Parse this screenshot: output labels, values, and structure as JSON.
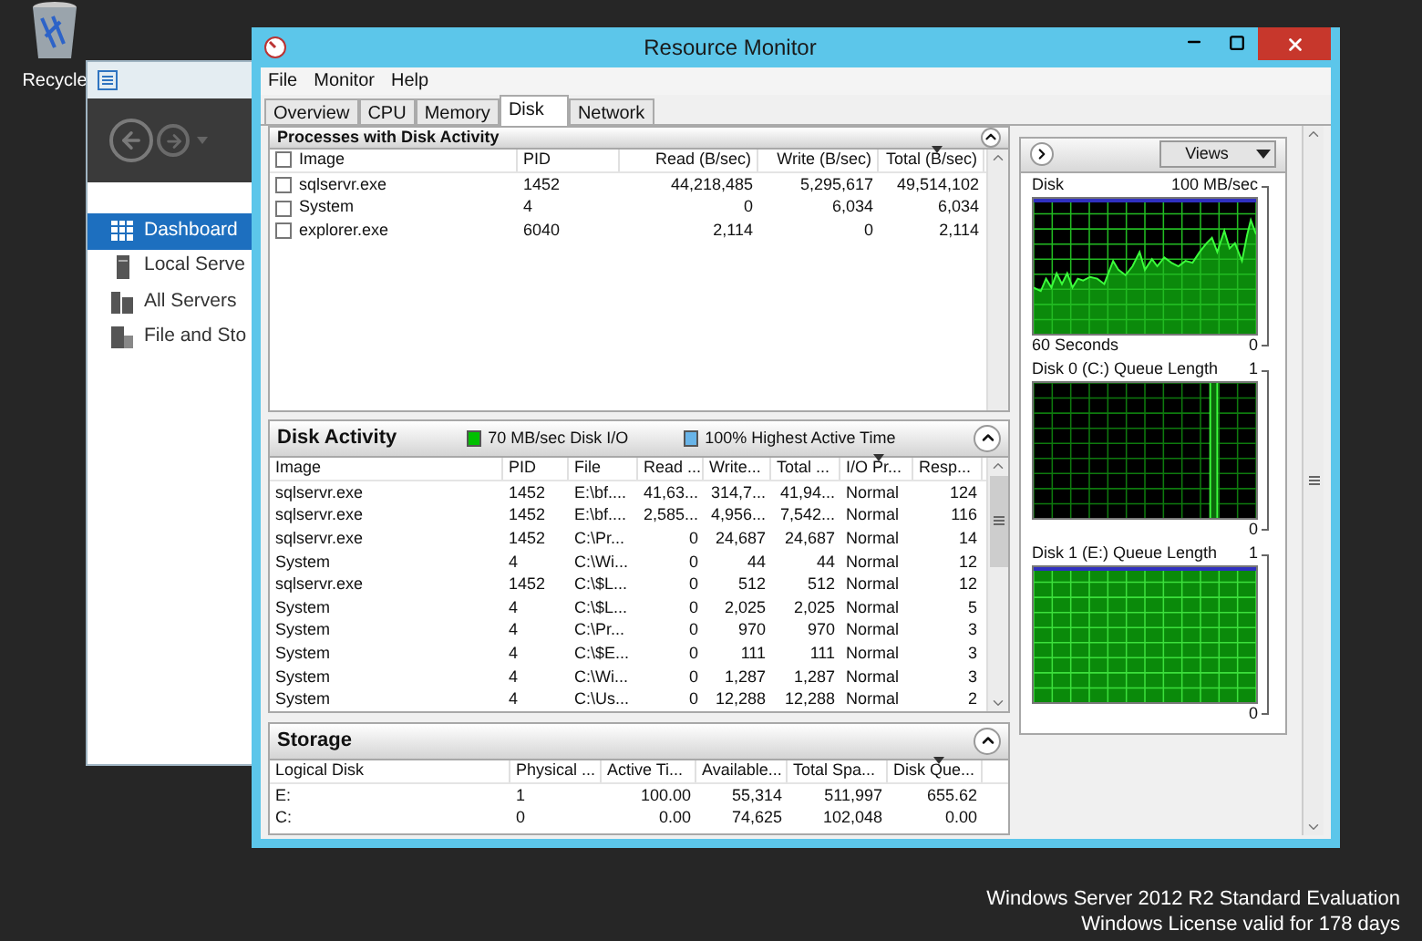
{
  "desktop": {
    "icons": [
      {
        "label": "Recycle"
      }
    ],
    "notice": [
      "Windows Server 2012 R2 Standard Evaluation",
      "Windows License valid for 178 days"
    ]
  },
  "server_manager": {
    "sidebar": {
      "items": [
        {
          "label": "Dashboard",
          "kind": "dashboard",
          "selected": true
        },
        {
          "label": "Local Serve",
          "kind": "server",
          "selected": false
        },
        {
          "label": "All Servers",
          "kind": "servers",
          "selected": false
        },
        {
          "label": "File and Sto",
          "kind": "storage",
          "selected": false
        }
      ]
    }
  },
  "resource_monitor": {
    "window": {
      "title": "Resource Monitor"
    },
    "menu": [
      "File",
      "Monitor",
      "Help"
    ],
    "tabs": [
      {
        "label": "Overview",
        "selected": false
      },
      {
        "label": "CPU",
        "selected": false
      },
      {
        "label": "Memory",
        "selected": false
      },
      {
        "label": "Disk",
        "selected": true
      },
      {
        "label": "Network",
        "selected": false
      }
    ],
    "processes": {
      "title": "Processes with Disk Activity",
      "expanded": true,
      "all_checked": false,
      "columns": [
        {
          "label": "Image",
          "sorted": false
        },
        {
          "label": "PID",
          "sorted": false
        },
        {
          "label": "Read (B/sec)",
          "sorted": false
        },
        {
          "label": "Write (B/sec)",
          "sorted": false
        },
        {
          "label": "Total (B/sec)",
          "sorted": true
        }
      ],
      "rows": [
        {
          "checked": false,
          "cells": [
            "sqlservr.exe",
            "1452",
            "44,218,485",
            "5,295,617",
            "49,514,102"
          ]
        },
        {
          "checked": false,
          "cells": [
            "System",
            "4",
            "0",
            "6,034",
            "6,034"
          ]
        },
        {
          "checked": false,
          "cells": [
            "explorer.exe",
            "6040",
            "2,114",
            "0",
            "2,114"
          ]
        }
      ]
    },
    "disk_activity": {
      "title": "Disk Activity",
      "expanded": true,
      "legend": [
        {
          "label": "70 MB/sec Disk I/O",
          "color": "#00c000"
        },
        {
          "label": "100% Highest Active Time",
          "color": "#68b4e8"
        }
      ],
      "columns": [
        {
          "label": "Image",
          "sorted": false
        },
        {
          "label": "PID",
          "sorted": false
        },
        {
          "label": "File",
          "sorted": false
        },
        {
          "label": "Read ...",
          "sorted": false
        },
        {
          "label": "Write...",
          "sorted": false
        },
        {
          "label": "Total ...",
          "sorted": false
        },
        {
          "label": "I/O Pr...",
          "sorted": true
        },
        {
          "label": "Resp...",
          "sorted": false
        }
      ],
      "rows": [
        [
          "sqlservr.exe",
          "1452",
          "E:\\bf....",
          "41,63...",
          "314,7...",
          "41,94...",
          "Normal",
          "124"
        ],
        [
          "sqlservr.exe",
          "1452",
          "E:\\bf....",
          "2,585...",
          "4,956...",
          "7,542...",
          "Normal",
          "116"
        ],
        [
          "sqlservr.exe",
          "1452",
          "C:\\Pr...",
          "0",
          "24,687",
          "24,687",
          "Normal",
          "14"
        ],
        [
          "System",
          "4",
          "C:\\Wi...",
          "0",
          "44",
          "44",
          "Normal",
          "12"
        ],
        [
          "sqlservr.exe",
          "1452",
          "C:\\$L...",
          "0",
          "512",
          "512",
          "Normal",
          "12"
        ],
        [
          "System",
          "4",
          "C:\\$L...",
          "0",
          "2,025",
          "2,025",
          "Normal",
          "5"
        ],
        [
          "System",
          "4",
          "C:\\Pr...",
          "0",
          "970",
          "970",
          "Normal",
          "3"
        ],
        [
          "System",
          "4",
          "C:\\$E...",
          "0",
          "111",
          "111",
          "Normal",
          "3"
        ],
        [
          "System",
          "4",
          "C:\\Wi...",
          "0",
          "1,287",
          "1,287",
          "Normal",
          "3"
        ],
        [
          "System",
          "4",
          "C:\\Us...",
          "0",
          "12,288",
          "12,288",
          "Normal",
          "2"
        ]
      ]
    },
    "storage": {
      "title": "Storage",
      "expanded": true,
      "columns": [
        {
          "label": "Logical Disk",
          "sorted": false
        },
        {
          "label": "Physical ...",
          "sorted": false
        },
        {
          "label": "Active Ti...",
          "sorted": false
        },
        {
          "label": "Available...",
          "sorted": false
        },
        {
          "label": "Total Spa...",
          "sorted": false
        },
        {
          "label": "Disk Que...",
          "sorted": true
        }
      ],
      "rows": [
        [
          "E:",
          "1",
          "100.00",
          "55,314",
          "511,997",
          "655.62"
        ],
        [
          "C:",
          "0",
          "0.00",
          "74,625",
          "102,048",
          "0.00"
        ]
      ]
    },
    "graphs_panel": {
      "views_label": "Views",
      "graphs": [
        {
          "kind": "area",
          "title": "Disk",
          "max": "100 MB/sec",
          "footer": "60 Seconds",
          "min": "0"
        },
        {
          "kind": "spike",
          "title": "Disk 0 (C:) Queue Length",
          "max": "1",
          "min": "0"
        },
        {
          "kind": "full",
          "title": "Disk 1 (E:) Queue Length",
          "max": "1",
          "min": "0"
        }
      ]
    }
  }
}
